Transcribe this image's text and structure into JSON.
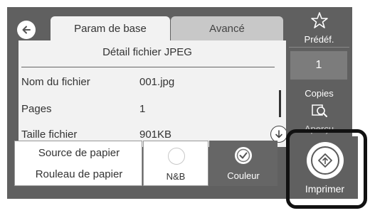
{
  "tabs": {
    "basic": "Param de base",
    "advanced": "Avancé"
  },
  "details": {
    "title": "Détail fichier JPEG",
    "rows": [
      {
        "label": "Nom du fichier",
        "value": "001.jpg"
      },
      {
        "label": "Pages",
        "value": "1"
      },
      {
        "label": "Taille fichier",
        "value": "901KB"
      }
    ]
  },
  "paper_source": {
    "title": "Source de papier",
    "value": "Rouleau de papier"
  },
  "color_mode": {
    "bw_label": "N&B",
    "color_label": "Couleur",
    "selected": "Couleur"
  },
  "sidebar": {
    "preset_label": "Prédéf.",
    "copies_value": "1",
    "copies_label": "Copies",
    "preview_label": "Aperçu",
    "print_label": "Imprimer"
  },
  "colors": {
    "screen_bg": "#606060",
    "panel_bg": "#f2f2f2",
    "highlight_frame": "#111111"
  },
  "icons": [
    "back-arrow-icon",
    "star-icon",
    "preview-zoom-icon",
    "scroll-down-icon",
    "checkmark-icon",
    "print-start-icon"
  ]
}
